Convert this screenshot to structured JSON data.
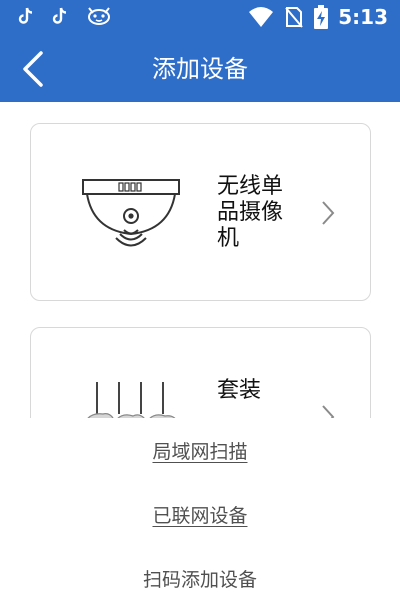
{
  "status_bar": {
    "time": "5:13",
    "left_icons": [
      "tiktok-icon",
      "tiktok-icon",
      "cat-face-icon"
    ],
    "right_icons": [
      "wifi-icon",
      "no-sim-icon",
      "battery-charging-icon"
    ]
  },
  "header": {
    "title": "添加设备",
    "back_icon": "chevron-left-icon",
    "background": "#2f6ec8"
  },
  "device_types": [
    {
      "label": "无线单品摄像机",
      "icon": "dome-camera-icon"
    },
    {
      "label": "套装",
      "icon": "nvr-kit-icon"
    }
  ],
  "bottom_sheet": {
    "options": [
      {
        "label": "局域网扫描"
      },
      {
        "label": "已联网设备"
      },
      {
        "label": "扫码添加设备"
      }
    ]
  }
}
